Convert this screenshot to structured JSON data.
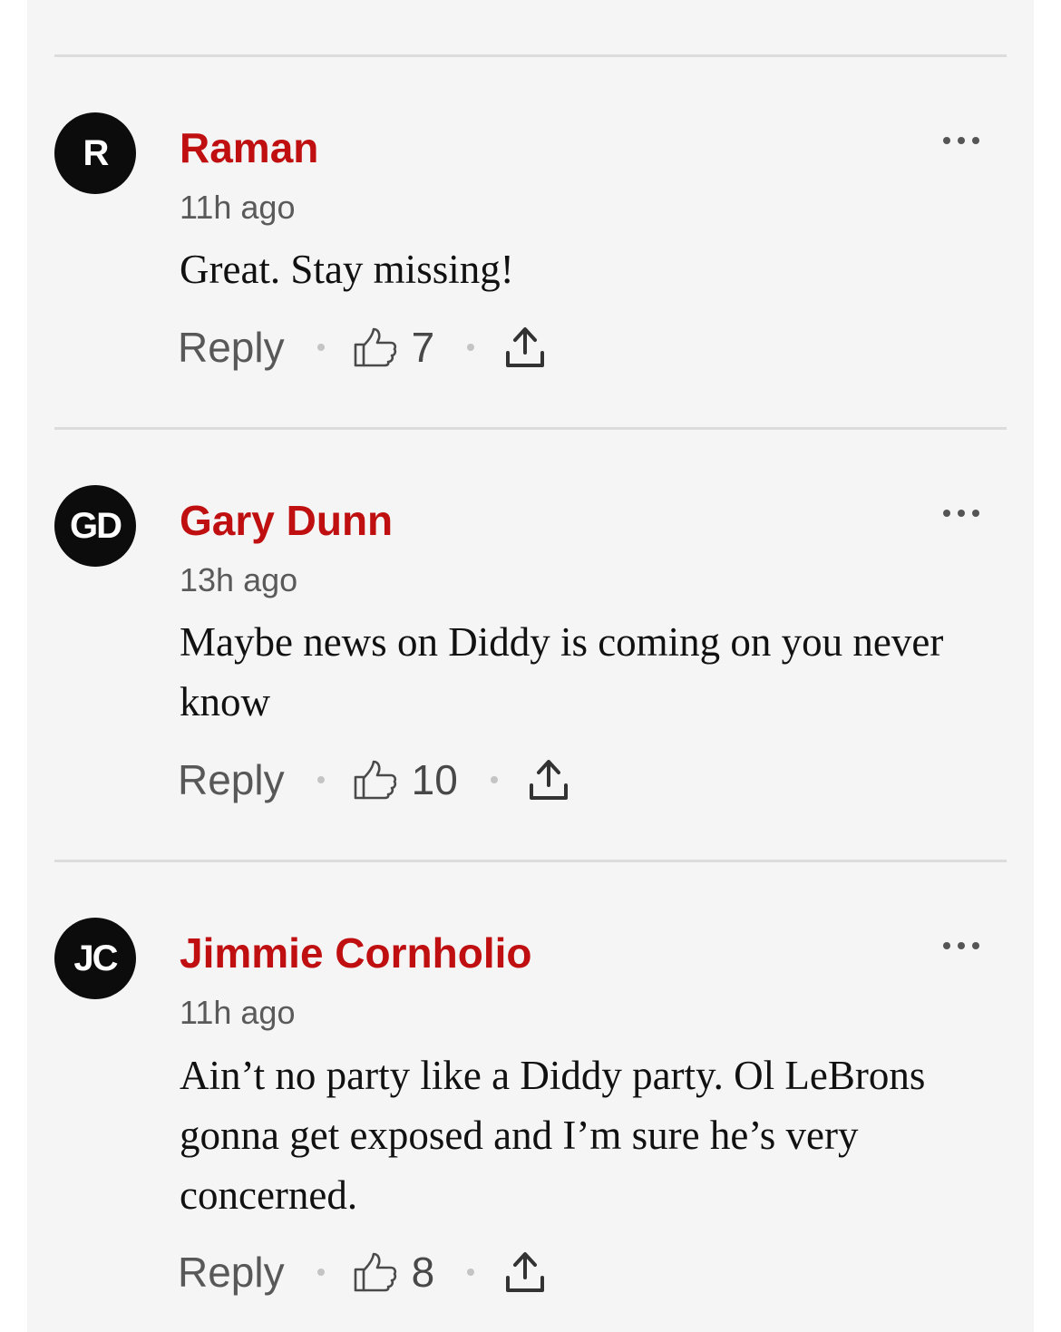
{
  "comments": [
    {
      "initials": "R",
      "author": "Raman",
      "time": "11h ago",
      "text": "Great. Stay missing!",
      "reply_label": "Reply",
      "likes": "7"
    },
    {
      "initials": "GD",
      "author": "Gary Dunn",
      "time": "13h ago",
      "text": "Maybe news on Diddy is coming on you never know",
      "reply_label": "Reply",
      "likes": "10"
    },
    {
      "initials": "JC",
      "author": "Jimmie Cornholio",
      "time": "11h ago",
      "text": "Ain’t no party like a Diddy party.  Ol LeBrons gonna get exposed and I’m sure he’s very concerned.",
      "reply_label": "Reply",
      "likes": "8"
    }
  ],
  "icons": {
    "like": "thumbs-up-icon",
    "share": "share-upload-icon",
    "more": "more-options-icon"
  },
  "colors": {
    "author": "#c00f10",
    "avatar_bg": "#0c0c0c",
    "panel_bg": "#f5f5f5"
  }
}
